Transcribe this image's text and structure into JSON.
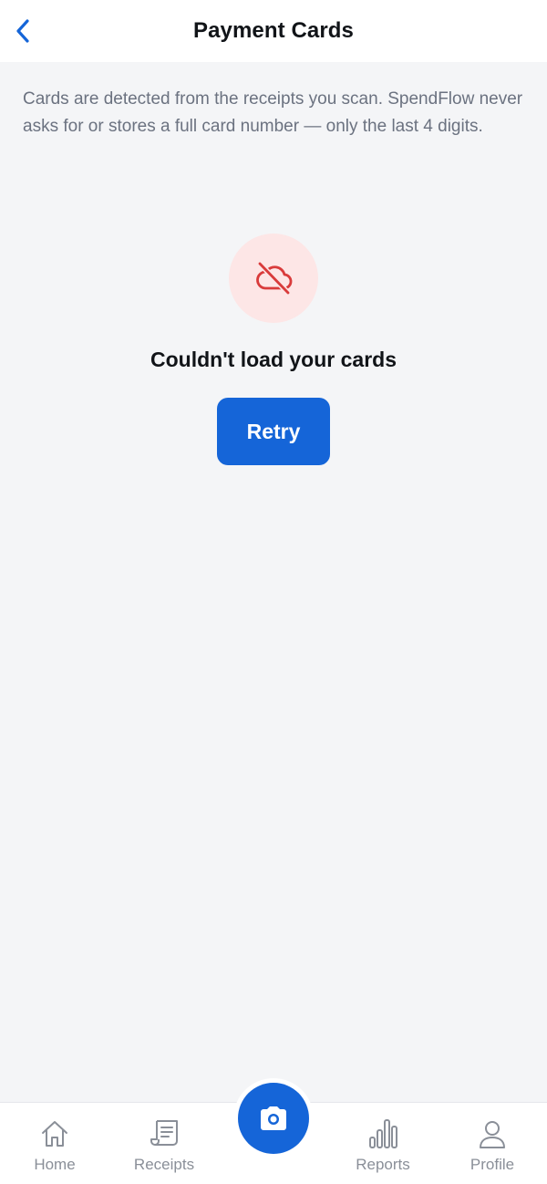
{
  "header": {
    "title": "Payment Cards",
    "back_icon": "chevron-left-icon"
  },
  "description": "Cards are detected from the receipts you scan. SpendFlow never asks for or stores a full card number — only the last 4 digits.",
  "error_state": {
    "icon": "cloud-off-icon",
    "title": "Couldn't load your cards",
    "retry_label": "Retry"
  },
  "tabbar": {
    "items": [
      {
        "label": "Home",
        "icon": "home-icon"
      },
      {
        "label": "Receipts",
        "icon": "receipt-icon"
      },
      {
        "label": "Reports",
        "icon": "bar-chart-icon"
      },
      {
        "label": "Profile",
        "icon": "user-icon"
      }
    ],
    "scan_icon": "camera-icon"
  },
  "colors": {
    "accent": "#1565d8",
    "error_icon": "#d93b3b",
    "error_bg": "#fde6e6",
    "background": "#f4f5f7",
    "muted_text": "#6b7280",
    "tab_inactive": "#8a8f98"
  }
}
